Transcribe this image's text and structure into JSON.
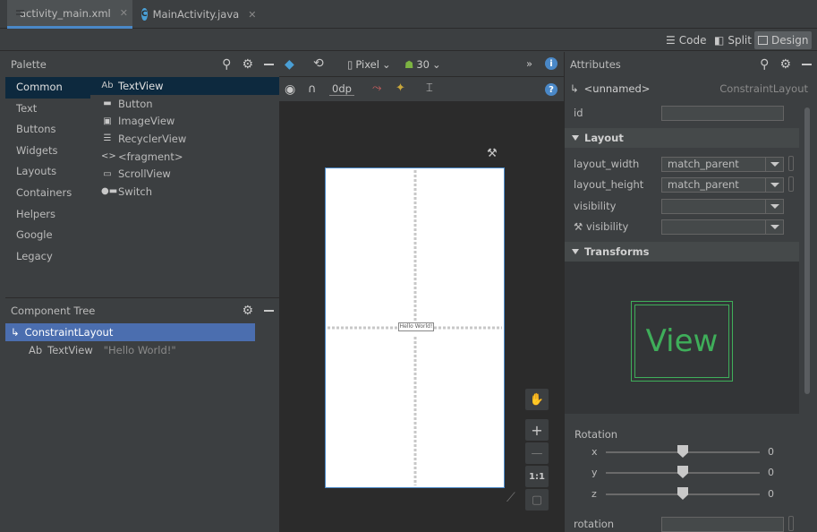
{
  "tabs": [
    {
      "label": "activity_main.xml",
      "icon": "xml-file-icon",
      "active": true
    },
    {
      "label": "MainActivity.java",
      "icon": "java-class-icon",
      "active": false
    }
  ],
  "view_modes": {
    "code": "Code",
    "split": "Split",
    "design": "Design",
    "selected": "Design"
  },
  "palette": {
    "title": "Palette",
    "categories": [
      "Common",
      "Text",
      "Buttons",
      "Widgets",
      "Layouts",
      "Containers",
      "Helpers",
      "Google",
      "Legacy"
    ],
    "selected_category": "Common",
    "items": [
      {
        "icon_text": "Ab",
        "label": "TextView"
      },
      {
        "icon_text": "",
        "label": "Button"
      },
      {
        "icon_text": "",
        "label": "ImageView"
      },
      {
        "icon_text": "",
        "label": "RecyclerView"
      },
      {
        "icon_text": "<>",
        "label": "<fragment>"
      },
      {
        "icon_text": "",
        "label": "ScrollView"
      },
      {
        "icon_text": "",
        "label": "Switch"
      }
    ]
  },
  "component_tree": {
    "title": "Component Tree",
    "root": "ConstraintLayout",
    "child_icon_text": "Ab",
    "child_label": "TextView",
    "child_hint": "\"Hello World!\""
  },
  "design_toolbar": {
    "device": "Pixel",
    "api": "30",
    "margin": "0dp",
    "more": "»"
  },
  "canvas": {
    "textview_text": "Hello World!",
    "zoom_plus": "+",
    "zoom_minus": "—",
    "zoom_ratio": "1:1"
  },
  "attributes": {
    "title": "Attributes",
    "selected_name": "<unnamed>",
    "selected_class": "ConstraintLayout",
    "id_label": "id",
    "id_value": "",
    "layout_section": "Layout",
    "layout_width_label": "layout_width",
    "layout_width_value": "match_parent",
    "layout_height_label": "layout_height",
    "layout_height_value": "match_parent",
    "visibility_label": "visibility",
    "visibility_value": "",
    "tools_visibility_label": "visibility",
    "tools_visibility_value": "",
    "transforms_section": "Transforms",
    "view_preview": "View",
    "rotation_label": "Rotation",
    "rotation": [
      {
        "axis": "x",
        "value": "0",
        "fraction": 0.5
      },
      {
        "axis": "y",
        "value": "0",
        "fraction": 0.5
      },
      {
        "axis": "z",
        "value": "0",
        "fraction": 0.5
      }
    ],
    "rotation_field_label": "rotation",
    "rotation_field_value": ""
  },
  "colors": {
    "accent": "#4a88c7",
    "selection_blue": "#4b6eaf",
    "view_preview_green": "#3fae5a"
  }
}
